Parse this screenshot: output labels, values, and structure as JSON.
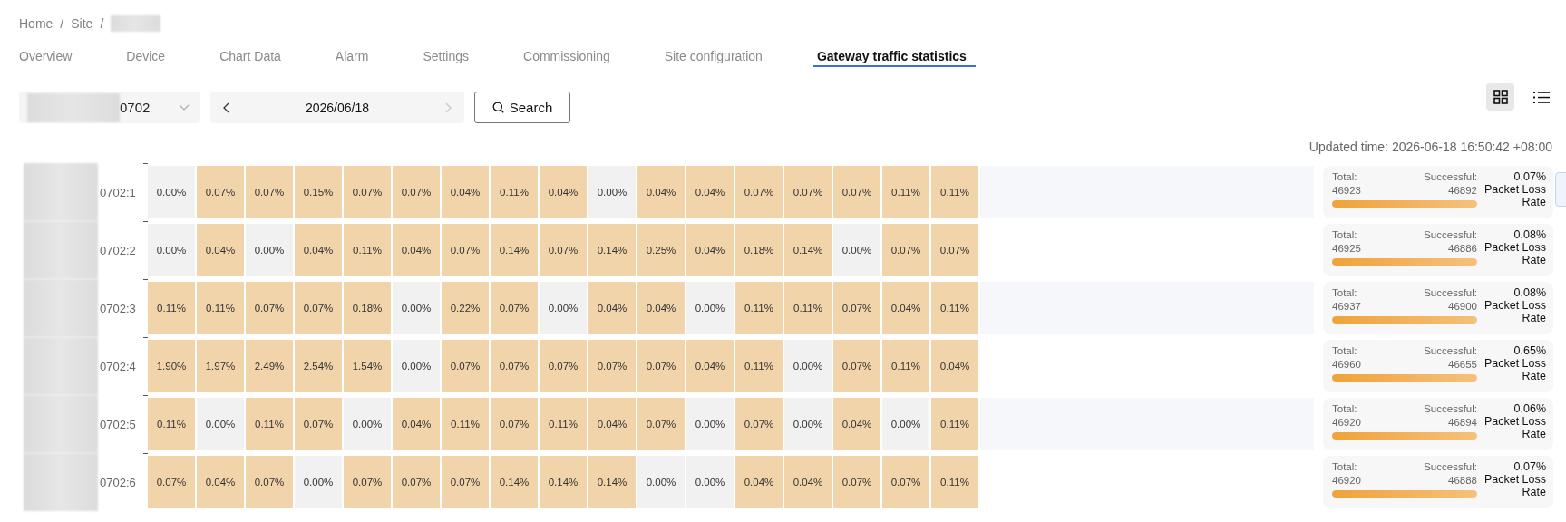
{
  "breadcrumb": [
    {
      "label": "Home",
      "separator": "/"
    },
    {
      "label": "Site",
      "separator": "/"
    }
  ],
  "tabs": [
    {
      "label": "Overview",
      "selected": false
    },
    {
      "label": "Device",
      "selected": false
    },
    {
      "label": "Chart Data",
      "selected": false
    },
    {
      "label": "Alarm",
      "selected": false
    },
    {
      "label": "Settings",
      "selected": false
    },
    {
      "label": "Commissioning",
      "selected": false
    },
    {
      "label": "Site configuration",
      "selected": false
    },
    {
      "label": "Gateway traffic statistics",
      "selected": true
    }
  ],
  "device_select": {
    "value": "0702"
  },
  "date_picker": {
    "value": "2026/06/18",
    "next_disabled": true
  },
  "search_button": "Search",
  "views": [
    {
      "kind": "grid",
      "selected": true
    },
    {
      "kind": "list",
      "selected": false
    }
  ],
  "updated_time": "Updated time: 2026-06-18 16:50:42 +08:00",
  "rows": [
    {
      "label": "0702:1",
      "cells": [
        {
          "value": "0.00%",
          "highlighted": false
        },
        {
          "value": "0.07%",
          "highlighted": true
        },
        {
          "value": "0.07%",
          "highlighted": true
        },
        {
          "value": "0.15%",
          "highlighted": true
        },
        {
          "value": "0.07%",
          "highlighted": true
        },
        {
          "value": "0.07%",
          "highlighted": true
        },
        {
          "value": "0.04%",
          "highlighted": true
        },
        {
          "value": "0.11%",
          "highlighted": true
        },
        {
          "value": "0.04%",
          "highlighted": true
        },
        {
          "value": "0.00%",
          "highlighted": false
        },
        {
          "value": "0.04%",
          "highlighted": true
        },
        {
          "value": "0.04%",
          "highlighted": true
        },
        {
          "value": "0.07%",
          "highlighted": true
        },
        {
          "value": "0.07%",
          "highlighted": true
        },
        {
          "value": "0.07%",
          "highlighted": true
        },
        {
          "value": "0.11%",
          "highlighted": true
        },
        {
          "value": "0.11%",
          "highlighted": true
        }
      ],
      "summary": {
        "total_label": "Total:",
        "total": "46923",
        "successful_label": "Successful:",
        "successful": "46892",
        "rate": "0.07%",
        "rate_label": "Packet Loss Rate",
        "level": 1
      }
    },
    {
      "label": "0702:2",
      "cells": [
        {
          "value": "0.00%",
          "highlighted": false
        },
        {
          "value": "0.04%",
          "highlighted": true
        },
        {
          "value": "0.00%",
          "highlighted": false
        },
        {
          "value": "0.04%",
          "highlighted": true
        },
        {
          "value": "0.11%",
          "highlighted": true
        },
        {
          "value": "0.04%",
          "highlighted": true
        },
        {
          "value": "0.07%",
          "highlighted": true
        },
        {
          "value": "0.14%",
          "highlighted": true
        },
        {
          "value": "0.07%",
          "highlighted": true
        },
        {
          "value": "0.14%",
          "highlighted": true
        },
        {
          "value": "0.25%",
          "highlighted": true
        },
        {
          "value": "0.04%",
          "highlighted": true
        },
        {
          "value": "0.18%",
          "highlighted": true
        },
        {
          "value": "0.14%",
          "highlighted": true
        },
        {
          "value": "0.00%",
          "highlighted": false
        },
        {
          "value": "0.07%",
          "highlighted": true
        },
        {
          "value": "0.07%",
          "highlighted": true
        }
      ],
      "summary": {
        "total_label": "Total:",
        "total": "46925",
        "successful_label": "Successful:",
        "successful": "46886",
        "rate": "0.08%",
        "rate_label": "Packet Loss Rate",
        "level": 1
      }
    },
    {
      "label": "0702:3",
      "cells": [
        {
          "value": "0.11%",
          "highlighted": true
        },
        {
          "value": "0.11%",
          "highlighted": true
        },
        {
          "value": "0.07%",
          "highlighted": true
        },
        {
          "value": "0.07%",
          "highlighted": true
        },
        {
          "value": "0.18%",
          "highlighted": true
        },
        {
          "value": "0.00%",
          "highlighted": false
        },
        {
          "value": "0.22%",
          "highlighted": true
        },
        {
          "value": "0.07%",
          "highlighted": true
        },
        {
          "value": "0.00%",
          "highlighted": false
        },
        {
          "value": "0.04%",
          "highlighted": true
        },
        {
          "value": "0.04%",
          "highlighted": true
        },
        {
          "value": "0.00%",
          "highlighted": false
        },
        {
          "value": "0.11%",
          "highlighted": true
        },
        {
          "value": "0.11%",
          "highlighted": true
        },
        {
          "value": "0.07%",
          "highlighted": true
        },
        {
          "value": "0.04%",
          "highlighted": true
        },
        {
          "value": "0.11%",
          "highlighted": true
        }
      ],
      "summary": {
        "total_label": "Total:",
        "total": "46937",
        "successful_label": "Successful:",
        "successful": "46900",
        "rate": "0.08%",
        "rate_label": "Packet Loss Rate",
        "level": 1
      }
    },
    {
      "label": "0702:4",
      "cells": [
        {
          "value": "1.90%",
          "highlighted": true
        },
        {
          "value": "1.97%",
          "highlighted": true
        },
        {
          "value": "2.49%",
          "highlighted": true
        },
        {
          "value": "2.54%",
          "highlighted": true
        },
        {
          "value": "1.54%",
          "highlighted": true
        },
        {
          "value": "0.00%",
          "highlighted": false
        },
        {
          "value": "0.07%",
          "highlighted": true
        },
        {
          "value": "0.07%",
          "highlighted": true
        },
        {
          "value": "0.07%",
          "highlighted": true
        },
        {
          "value": "0.07%",
          "highlighted": true
        },
        {
          "value": "0.07%",
          "highlighted": true
        },
        {
          "value": "0.04%",
          "highlighted": true
        },
        {
          "value": "0.11%",
          "highlighted": true
        },
        {
          "value": "0.00%",
          "highlighted": false
        },
        {
          "value": "0.07%",
          "highlighted": true
        },
        {
          "value": "0.11%",
          "highlighted": true
        },
        {
          "value": "0.04%",
          "highlighted": true
        }
      ],
      "summary": {
        "total_label": "Total:",
        "total": "46960",
        "successful_label": "Successful:",
        "successful": "46655",
        "rate": "0.65%",
        "rate_label": "Packet Loss Rate",
        "level": 1
      }
    },
    {
      "label": "0702:5",
      "cells": [
        {
          "value": "0.11%",
          "highlighted": true
        },
        {
          "value": "0.00%",
          "highlighted": false
        },
        {
          "value": "0.11%",
          "highlighted": true
        },
        {
          "value": "0.07%",
          "highlighted": true
        },
        {
          "value": "0.00%",
          "highlighted": false
        },
        {
          "value": "0.04%",
          "highlighted": true
        },
        {
          "value": "0.11%",
          "highlighted": true
        },
        {
          "value": "0.07%",
          "highlighted": true
        },
        {
          "value": "0.11%",
          "highlighted": true
        },
        {
          "value": "0.04%",
          "highlighted": true
        },
        {
          "value": "0.07%",
          "highlighted": true
        },
        {
          "value": "0.00%",
          "highlighted": false
        },
        {
          "value": "0.07%",
          "highlighted": true
        },
        {
          "value": "0.00%",
          "highlighted": false
        },
        {
          "value": "0.04%",
          "highlighted": true
        },
        {
          "value": "0.00%",
          "highlighted": false
        },
        {
          "value": "0.11%",
          "highlighted": true
        }
      ],
      "summary": {
        "total_label": "Total:",
        "total": "46920",
        "successful_label": "Successful:",
        "successful": "46894",
        "rate": "0.06%",
        "rate_label": "Packet Loss Rate",
        "level": 1
      }
    },
    {
      "label": "0702:6",
      "cells": [
        {
          "value": "0.07%",
          "highlighted": true
        },
        {
          "value": "0.04%",
          "highlighted": true
        },
        {
          "value": "0.07%",
          "highlighted": true
        },
        {
          "value": "0.00%",
          "highlighted": false
        },
        {
          "value": "0.07%",
          "highlighted": true
        },
        {
          "value": "0.07%",
          "highlighted": true
        },
        {
          "value": "0.07%",
          "highlighted": true
        },
        {
          "value": "0.14%",
          "highlighted": true
        },
        {
          "value": "0.14%",
          "highlighted": true
        },
        {
          "value": "0.14%",
          "highlighted": true
        },
        {
          "value": "0.00%",
          "highlighted": false
        },
        {
          "value": "0.00%",
          "highlighted": false
        },
        {
          "value": "0.04%",
          "highlighted": true
        },
        {
          "value": "0.04%",
          "highlighted": true
        },
        {
          "value": "0.07%",
          "highlighted": true
        },
        {
          "value": "0.07%",
          "highlighted": true
        },
        {
          "value": "0.11%",
          "highlighted": true
        }
      ],
      "summary": {
        "total_label": "Total:",
        "total": "46920",
        "successful_label": "Successful:",
        "successful": "46888",
        "rate": "0.07%",
        "rate_label": "Packet Loss Rate",
        "level": 1
      }
    }
  ]
}
